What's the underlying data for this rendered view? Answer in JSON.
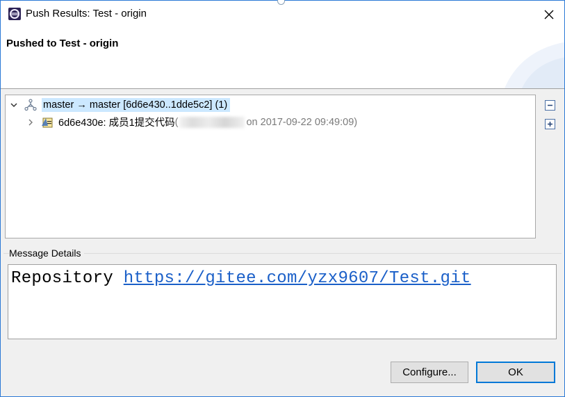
{
  "window": {
    "title": "Push Results: Test - origin"
  },
  "banner": {
    "title": "Pushed to Test - origin"
  },
  "tree": {
    "ref_update": {
      "label": "master → master [6d6e430..1dde5c2] (1)"
    },
    "commit": {
      "label": "6d6e430e: 成员1提交代码",
      "paren_open": " (",
      "date_text": "on 2017-09-22 09:49:09)"
    }
  },
  "side_buttons": {
    "collapse_icon": "minus-box",
    "expand_icon": "plus-box"
  },
  "message_details": {
    "label": "Message Details",
    "prefix": "Repository ",
    "url": "https://gitee.com/yzx9607/Test.git"
  },
  "buttons": {
    "configure": "Configure...",
    "ok": "OK"
  },
  "colors": {
    "accent": "#0078d7",
    "selection": "#cce8ff",
    "link": "#1a5fc8"
  }
}
